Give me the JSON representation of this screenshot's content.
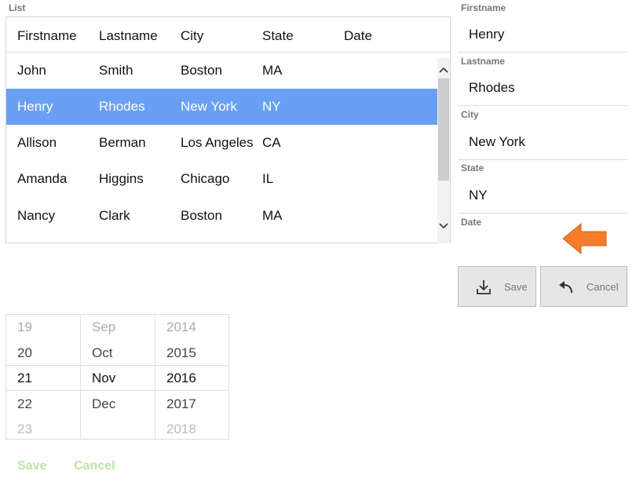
{
  "list": {
    "section_label": "List",
    "columns": [
      "Firstname",
      "Lastname",
      "City",
      "State",
      "Date"
    ],
    "rows": [
      {
        "firstname": "John",
        "lastname": "Smith",
        "city": "Boston",
        "state": "MA",
        "date": ""
      },
      {
        "firstname": "Henry",
        "lastname": "Rhodes",
        "city": "New York",
        "state": "NY",
        "date": ""
      },
      {
        "firstname": "Allison",
        "lastname": "Berman",
        "city": "Los Angeles",
        "state": "CA",
        "date": ""
      },
      {
        "firstname": "Amanda",
        "lastname": "Higgins",
        "city": "Chicago",
        "state": "IL",
        "date": ""
      },
      {
        "firstname": "Nancy",
        "lastname": "Clark",
        "city": "Boston",
        "state": "MA",
        "date": ""
      }
    ],
    "selected_index": 1
  },
  "form": {
    "firstname_label": "Firstname",
    "firstname_value": "Henry",
    "lastname_label": "Lastname",
    "lastname_value": "Rhodes",
    "city_label": "City",
    "city_value": "New York",
    "state_label": "State",
    "state_value": "NY",
    "date_label": "Date",
    "date_value": ""
  },
  "buttons": {
    "save_label": "Save",
    "cancel_label": "Cancel"
  },
  "date_picker": {
    "days": [
      "19",
      "20",
      "21",
      "22",
      "23"
    ],
    "months": [
      "Sep",
      "Oct",
      "Nov",
      "Dec",
      ""
    ],
    "years": [
      "2014",
      "2015",
      "2016",
      "2017",
      "2018"
    ],
    "selected": {
      "day": "21",
      "month": "Nov",
      "year": "2016"
    }
  },
  "bottom_actions": {
    "save_label": "Save",
    "cancel_label": "Cancel"
  },
  "colors": {
    "selection": "#6aa0f4",
    "arrow": "#f57c2a",
    "disabled_green": "#b6e6a7"
  },
  "icons": [
    "download-icon",
    "undo-arrow-icon",
    "left-arrow-icon",
    "chevron-up-icon",
    "chevron-down-icon"
  ]
}
